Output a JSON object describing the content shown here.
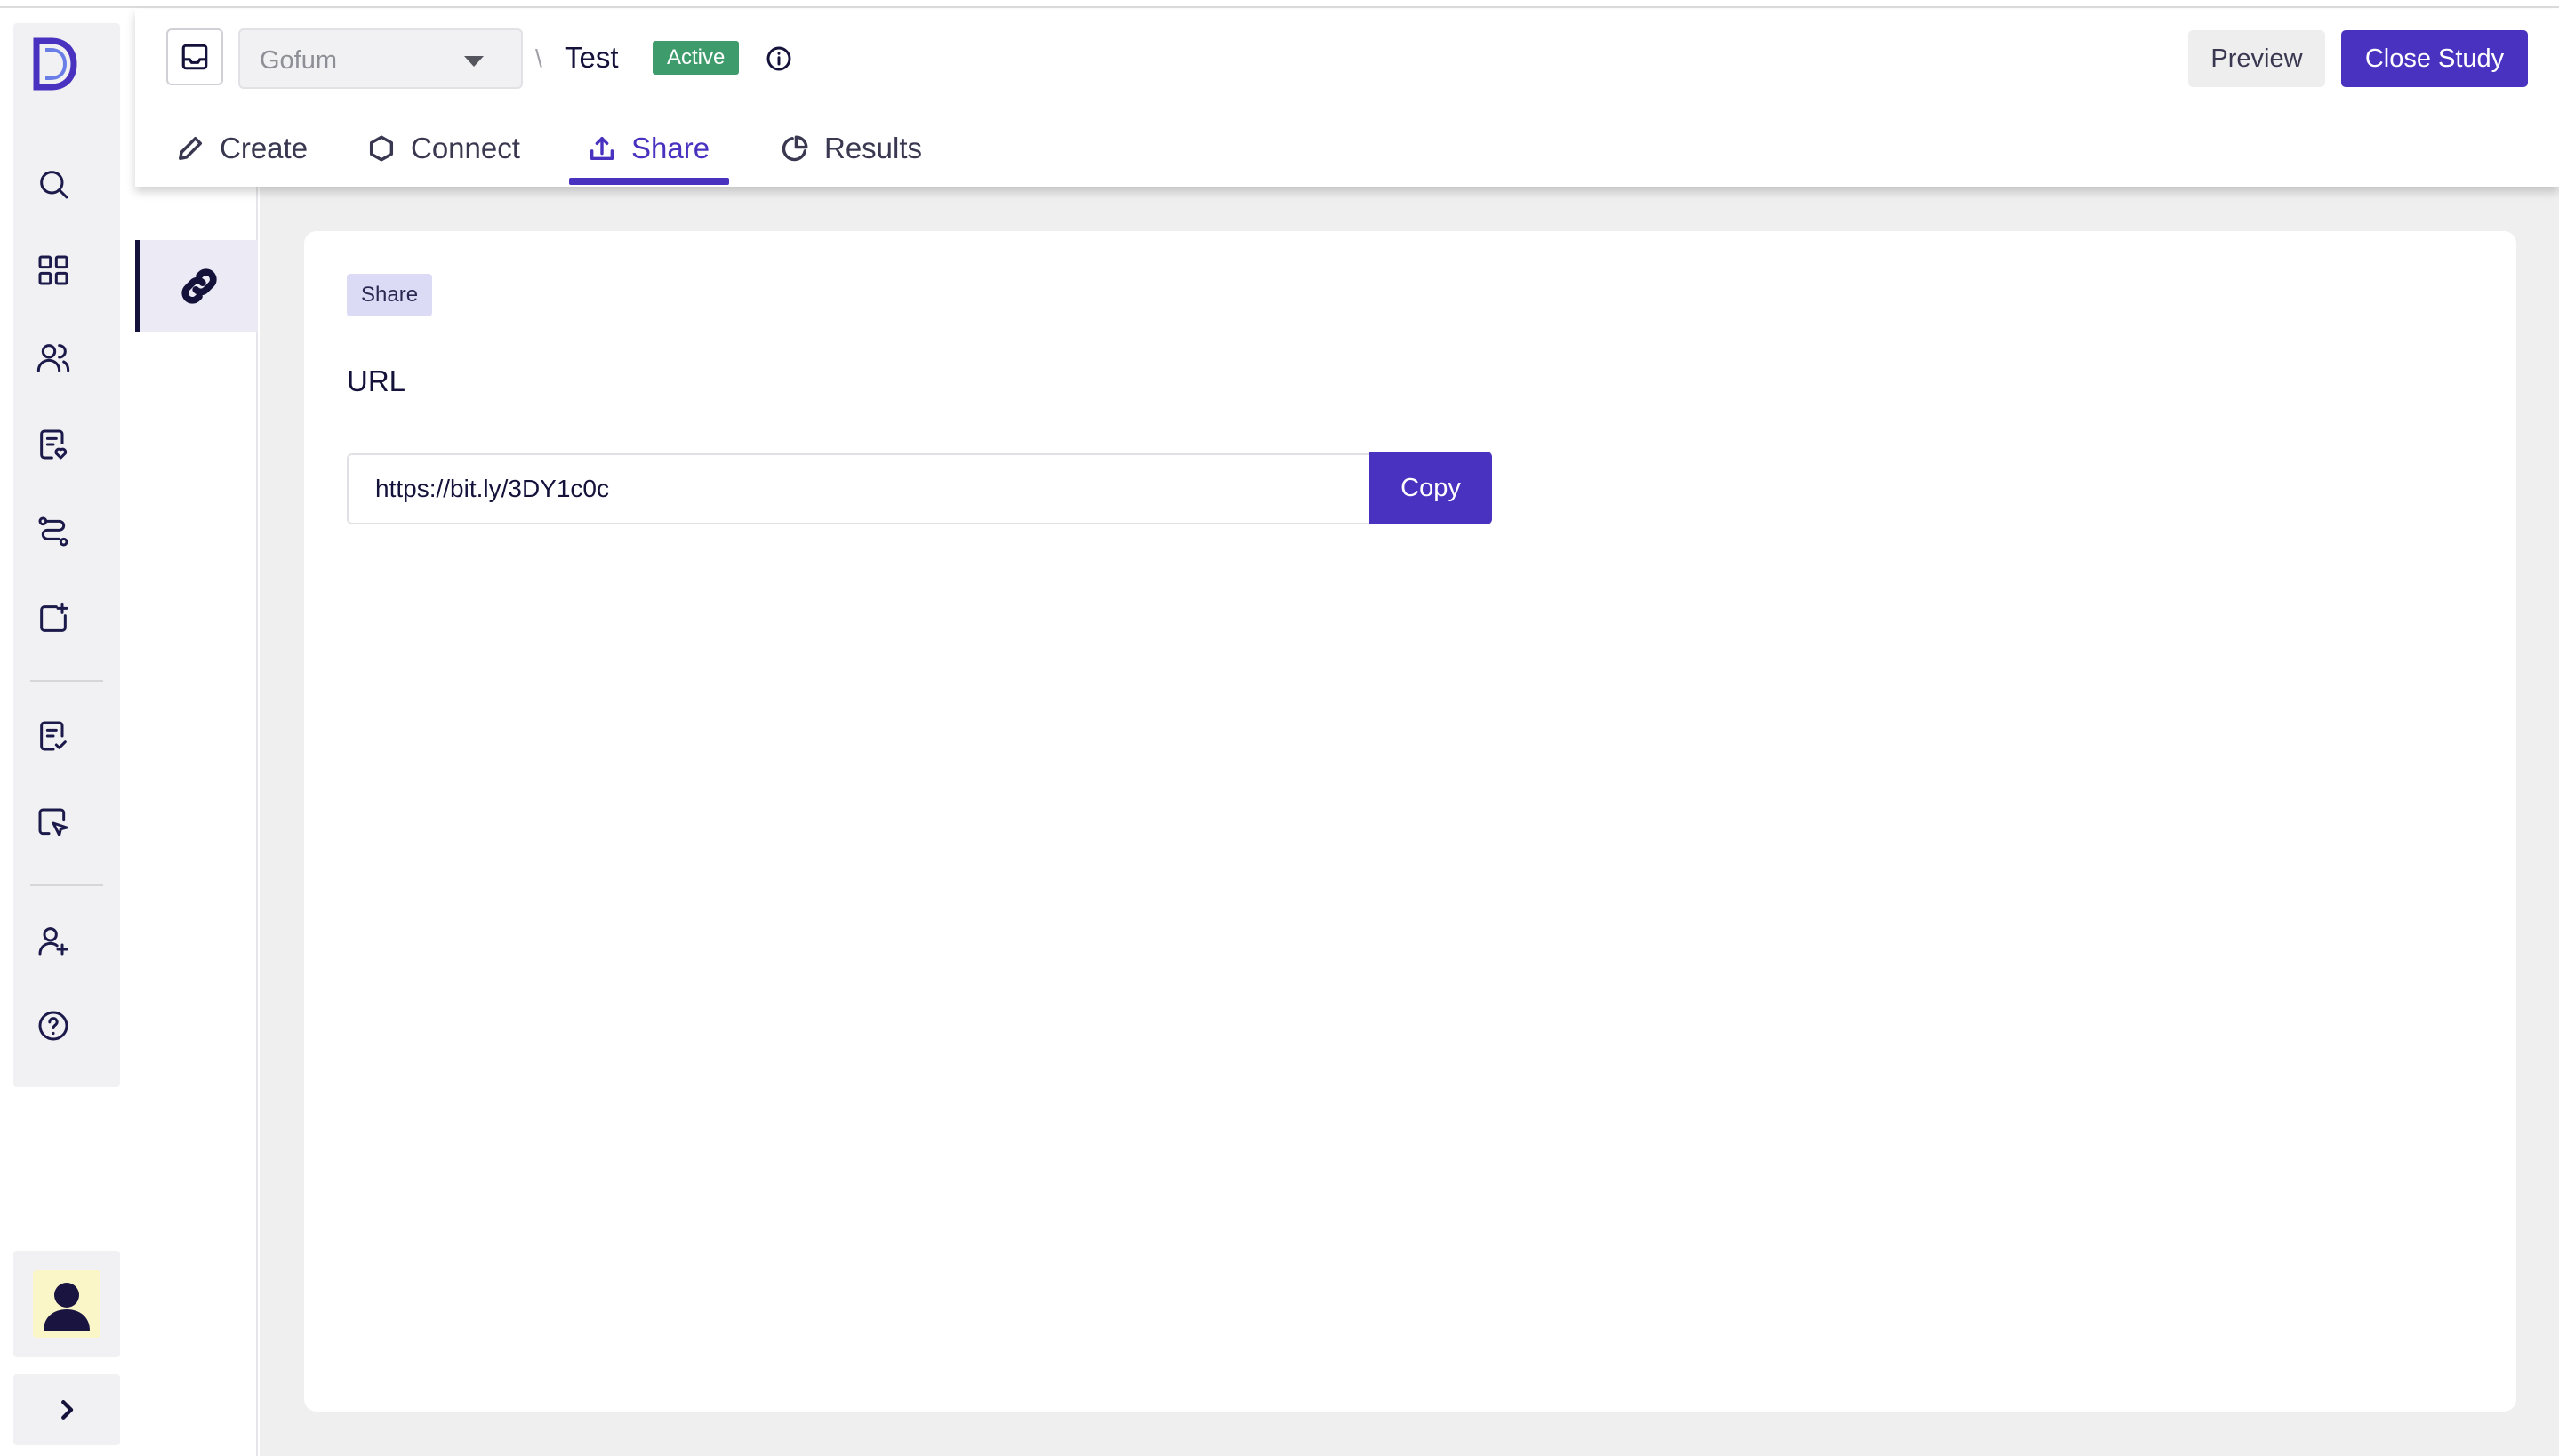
{
  "app": {
    "logo_letter": "D",
    "brand_color": "#4a32c0"
  },
  "rail": {
    "items": [
      {
        "name": "search-icon"
      },
      {
        "name": "dashboard-grid-icon"
      },
      {
        "name": "users-icon"
      },
      {
        "name": "document-heart-icon"
      },
      {
        "name": "route-icon"
      },
      {
        "name": "add-folder-icon"
      },
      {
        "name": "checklist-icon"
      },
      {
        "name": "cursor-select-icon"
      },
      {
        "name": "add-user-icon"
      },
      {
        "name": "help-icon"
      }
    ],
    "expand_icon": "chevron-right-icon"
  },
  "header": {
    "workspace": "Gofum",
    "separator": "\\",
    "study_title": "Test",
    "status": "Active",
    "status_color": "#3e9b6b",
    "preview_label": "Preview",
    "close_label": "Close Study"
  },
  "tabs": [
    {
      "label": "Create",
      "icon": "pencil-icon",
      "active": false
    },
    {
      "label": "Connect",
      "icon": "hexagon-icon",
      "active": false
    },
    {
      "label": "Share",
      "icon": "upload-icon",
      "active": true
    },
    {
      "label": "Results",
      "icon": "pie-chart-icon",
      "active": false
    }
  ],
  "subnav": {
    "active_icon": "link-icon"
  },
  "share": {
    "chip": "Share",
    "url_label": "URL",
    "url_value": "https://bit.ly/3DY1c0c",
    "copy_label": "Copy"
  }
}
